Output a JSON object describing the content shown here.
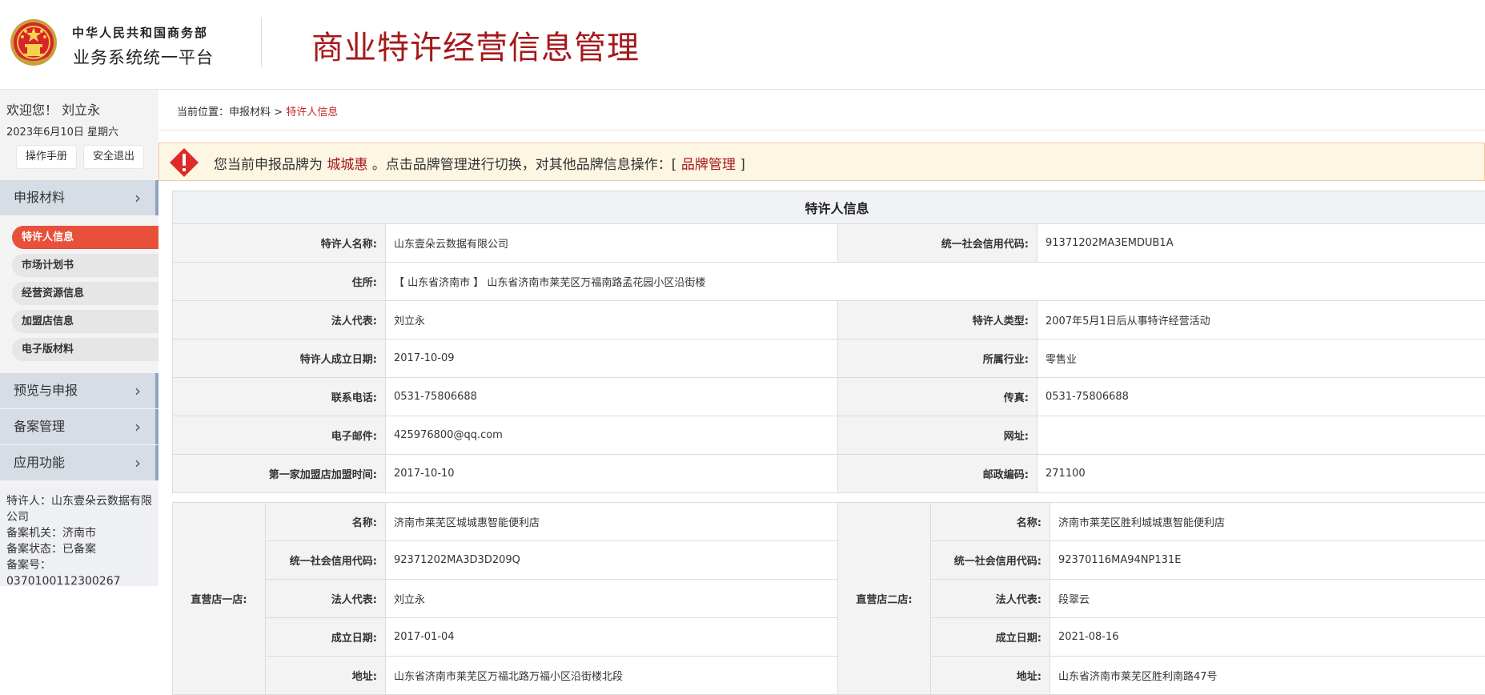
{
  "header": {
    "org_line1": "中华人民共和国商务部",
    "org_line2": "业务系统统一平台",
    "system_title": "商业特许经营信息管理",
    "emblem_icon": "national-emblem-icon"
  },
  "sidebar": {
    "welcome": "欢迎您！ 刘立永",
    "date": "2023年6月10日 星期六",
    "manual_btn": "操作手册",
    "logout_btn": "安全退出",
    "menu": [
      {
        "label": "申报材料",
        "icon": "chevron-right-icon"
      },
      {
        "label": "预览与申报",
        "icon": "chevron-right-icon"
      },
      {
        "label": "备案管理",
        "icon": "chevron-right-icon"
      },
      {
        "label": "应用功能",
        "icon": "chevron-right-icon"
      }
    ],
    "submenu": [
      {
        "label": "特许人信息",
        "active": true
      },
      {
        "label": "市场计划书",
        "active": false
      },
      {
        "label": "经营资源信息",
        "active": false
      },
      {
        "label": "加盟店信息",
        "active": false
      },
      {
        "label": "电子版材料",
        "active": false
      }
    ],
    "status": {
      "franchisor": "特许人：山东壹朵云数据有限公司",
      "authority": "备案机关：济南市",
      "state": "备案状态：已备案",
      "number": "备案号：0370100112300267"
    },
    "colors": {
      "active": "#e8503a",
      "menu_bg": "#d7dde5"
    }
  },
  "breadcrumb": {
    "prefix": "当前位置：",
    "parent": "申报材料",
    "sep": " > ",
    "current": "特许人信息"
  },
  "notice": {
    "icon": "warning-diamond-icon",
    "part1": "您当前申报品牌为 ",
    "brand": "城城惠",
    "part2": " 。点击品牌管理进行切换，对其他品牌信息操作：[ ",
    "link": "品牌管理",
    "part3": " ]"
  },
  "info": {
    "title": "特许人信息",
    "name_label": "特许人名称:",
    "name": "山东壹朵云数据有限公司",
    "credit_label": "统一社会信用代码:",
    "credit": "91371202MA3EMDUB1A",
    "address_label": "住所:",
    "address": "【 山东省济南市 】 山东省济南市莱芜区万福南路孟花园小区沿街楼",
    "legal_label": "法人代表:",
    "legal": "刘立永",
    "type_label": "特许人类型:",
    "type": "2007年5月1日后从事特许经营活动",
    "founded_label": "特许人成立日期:",
    "founded": "2017-10-09",
    "industry_label": "所属行业:",
    "industry": "零售业",
    "phone_label": "联系电话:",
    "phone": "0531-75806688",
    "fax_label": "传真:",
    "fax": "0531-75806688",
    "email_label": "电子邮件:",
    "email": "425976800@qq.com",
    "website_label": "网址:",
    "website": "",
    "first_join_label": "第一家加盟店加盟时间:",
    "first_join": "2017-10-10",
    "postcode_label": "邮政编码:",
    "postcode": "271100"
  },
  "stores": [
    {
      "title": "直营店一店:",
      "name_label": "名称:",
      "name": "济南市莱芜区城城惠智能便利店",
      "credit_label": "统一社会信用代码:",
      "credit": "92371202MA3D3D209Q",
      "legal_label": "法人代表:",
      "legal": "刘立永",
      "founded_label": "成立日期:",
      "founded": "2017-01-04",
      "address_label": "地址:",
      "address": "山东省济南市莱芜区万福北路万福小区沿街楼北段"
    },
    {
      "title": "直营店二店:",
      "name_label": "名称:",
      "name": "济南市莱芜区胜利城城惠智能便利店",
      "credit_label": "统一社会信用代码:",
      "credit": "92370116MA94NP131E",
      "legal_label": "法人代表:",
      "legal": "段翠云",
      "founded_label": "成立日期:",
      "founded": "2021-08-16",
      "address_label": "地址:",
      "address": "山东省济南市莱芜区胜利南路47号"
    }
  ]
}
